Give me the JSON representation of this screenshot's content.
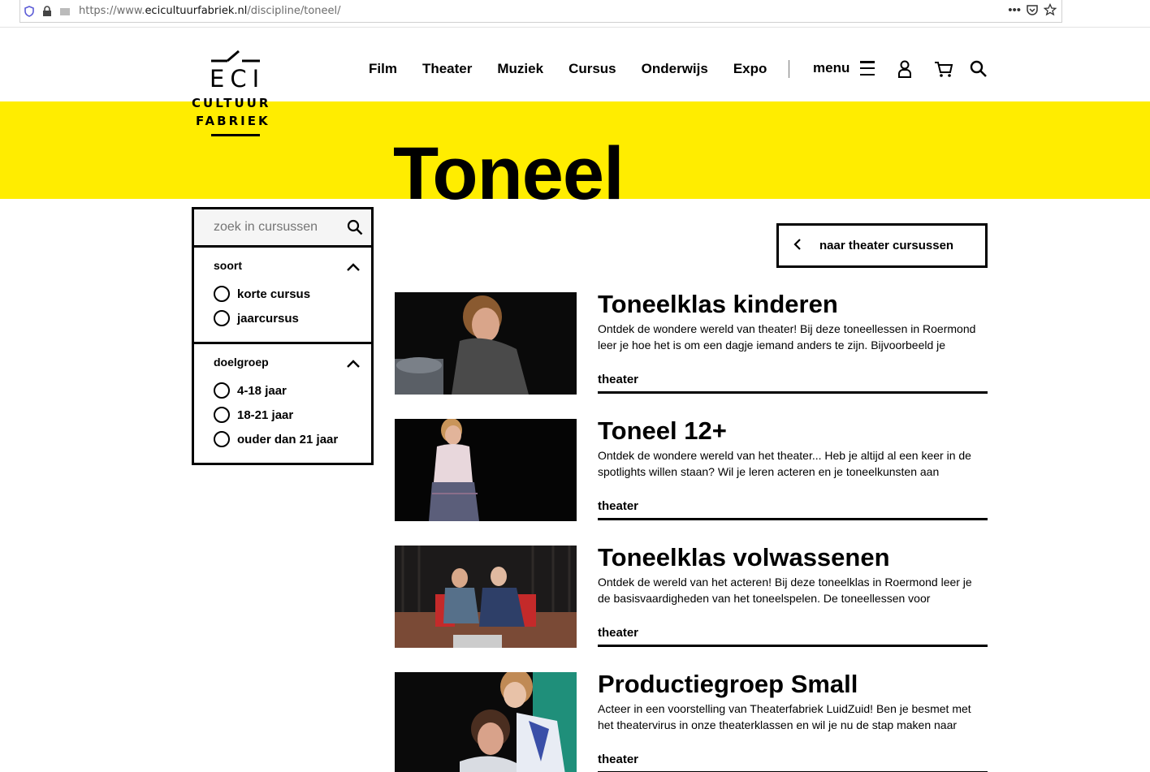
{
  "browser": {
    "url_prefix": "https://www.",
    "url_domain": "ecicultuurfabriek.nl",
    "url_path": "/discipline/toneel/",
    "more_glyph": "•••"
  },
  "logo": {
    "line1": "ECI",
    "line2": "CULTUUR",
    "line3": "FABRIEK"
  },
  "nav": {
    "items": [
      "Film",
      "Theater",
      "Muziek",
      "Cursus",
      "Onderwijs",
      "Expo"
    ],
    "menu_label": "menu"
  },
  "page": {
    "title": "Toneel"
  },
  "sidebar": {
    "search_placeholder": "zoek in cursussen",
    "groups": [
      {
        "title": "soort",
        "options": [
          "korte cursus",
          "jaarcursus"
        ]
      },
      {
        "title": "doelgroep",
        "options": [
          "4-18 jaar",
          "18-21 jaar",
          "ouder dan 21 jaar"
        ]
      }
    ]
  },
  "back_button": {
    "label": "naar theater cursussen"
  },
  "courses": [
    {
      "title": "Toneelklas kinderen",
      "description": "Ontdek de wondere wereld van theater! Bij deze toneellessen in Roermond leer je hoe het is om een dagje iemand anders te zijn. Bijvoorbeeld je",
      "tag": "theater"
    },
    {
      "title": "Toneel 12+",
      "description": "Ontdek de wondere wereld van het theater... Heb je altijd al een keer in de spotlights willen staan? Wil je leren acteren en je toneelkunsten aan",
      "tag": "theater"
    },
    {
      "title": "Toneelklas volwassenen",
      "description": "Ontdek de wereld van het acteren! Bij deze toneelklas in Roermond leer je de basisvaardigheden van het toneelspelen. De toneellessen voor",
      "tag": "theater"
    },
    {
      "title": "Productiegroep Small",
      "description": "Acteer in een voorstelling van Theaterfabriek LuidZuid! Ben je besmet met het theatervirus in onze theaterklassen en wil je nu de stap maken naar",
      "tag": "theater"
    }
  ],
  "colors": {
    "accent_yellow": "#ffed00",
    "text": "#000000"
  },
  "icons": [
    "shield-icon",
    "lock-icon",
    "page-icon",
    "more-icon",
    "pocket-icon",
    "star-icon",
    "hamburger-icon",
    "user-icon",
    "cart-icon",
    "search-icon",
    "chevron-up-icon",
    "chevron-left-icon"
  ]
}
